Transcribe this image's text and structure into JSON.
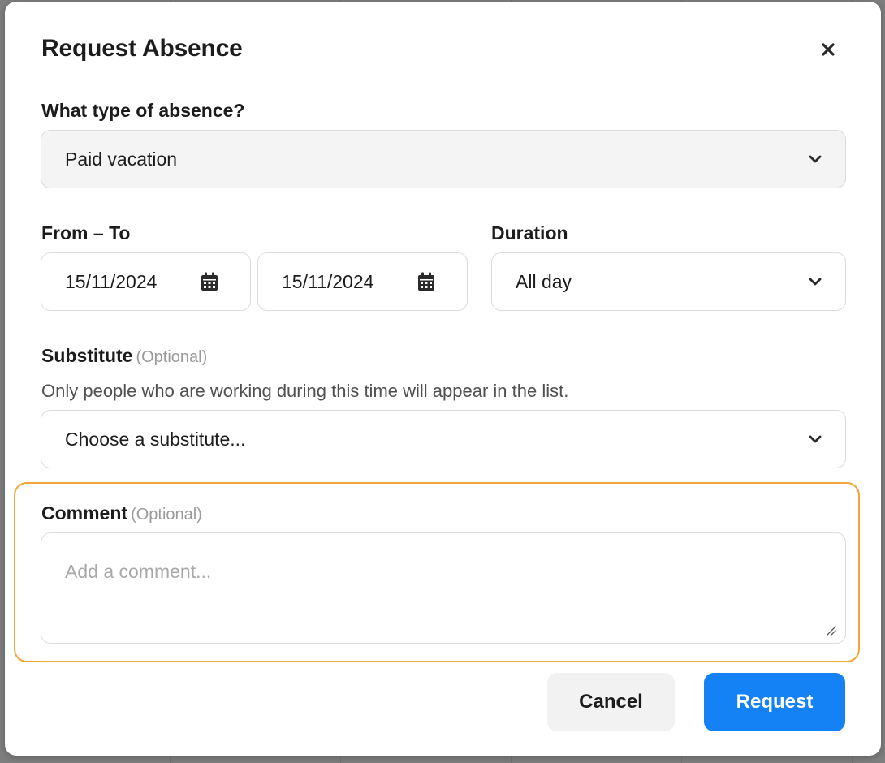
{
  "dialog": {
    "title": "Request Absence",
    "close_icon": "close-icon"
  },
  "absence_type": {
    "label": "What type of absence?",
    "value": "Paid vacation"
  },
  "dates": {
    "label": "From – To",
    "from": "15/11/2024",
    "to": "15/11/2024",
    "icon": "calendar-icon"
  },
  "duration": {
    "label": "Duration",
    "value": "All day"
  },
  "substitute": {
    "label": "Substitute",
    "optional": "(Optional)",
    "hint": "Only people who are working during this time will appear in the list.",
    "placeholder": "Choose a substitute..."
  },
  "comment": {
    "label": "Comment",
    "optional": "(Optional)",
    "placeholder": "Add a comment...",
    "value": ""
  },
  "actions": {
    "cancel": "Cancel",
    "request": "Request"
  },
  "colors": {
    "accent": "#1482f4",
    "focus_outline": "#f0a63a"
  }
}
